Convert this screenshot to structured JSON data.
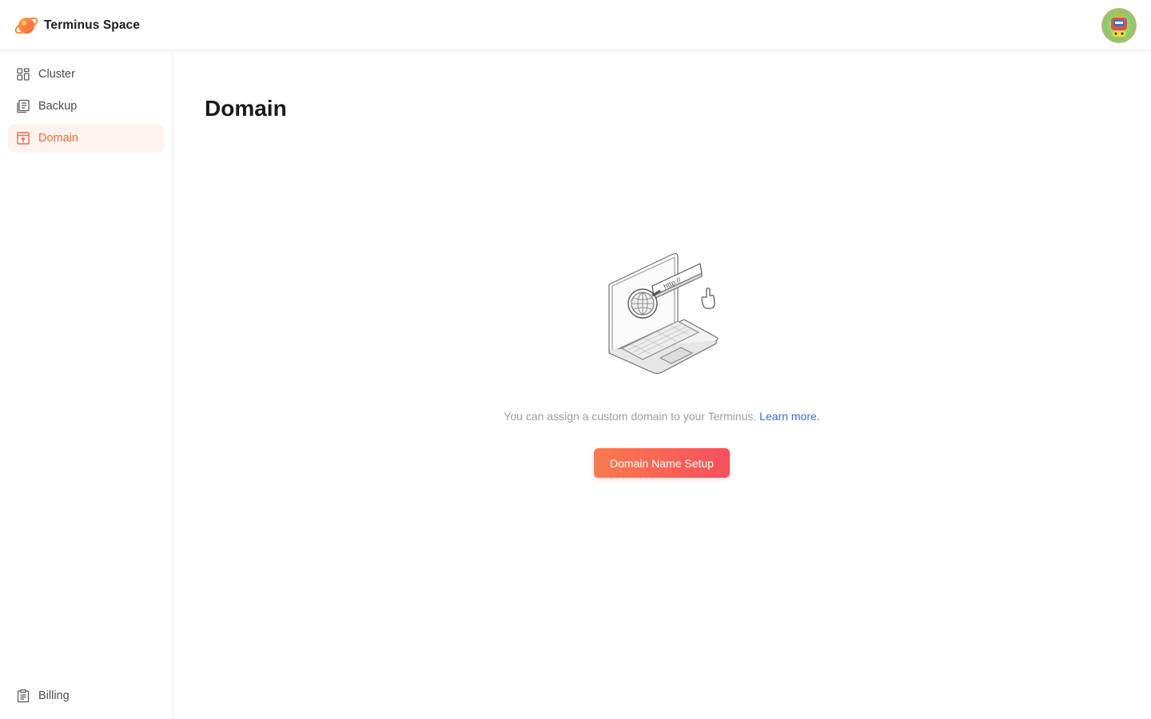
{
  "app": {
    "name": "Terminus Space"
  },
  "sidebar": {
    "items": [
      {
        "label": "Cluster",
        "icon": "cluster-grid-icon"
      },
      {
        "label": "Backup",
        "icon": "backup-stack-icon"
      },
      {
        "label": "Domain",
        "icon": "domain-browser-icon",
        "active": true
      }
    ],
    "bottom": {
      "label": "Billing",
      "icon": "billing-clipboard-icon"
    }
  },
  "main": {
    "title": "Domain",
    "illustration": "laptop-with-magnifier-http-illustration",
    "illustration_text": "http://",
    "description": "You can assign a custom domain to your Terminus.",
    "learn_more": "Learn more.",
    "cta_label": "Domain Name Setup"
  },
  "theme": {
    "accent": "#f26b3a",
    "active_bg": "#fff3ef",
    "link": "#2f6fd6",
    "gradient_start": "#f97a4e",
    "gradient_end": "#f6505e"
  }
}
